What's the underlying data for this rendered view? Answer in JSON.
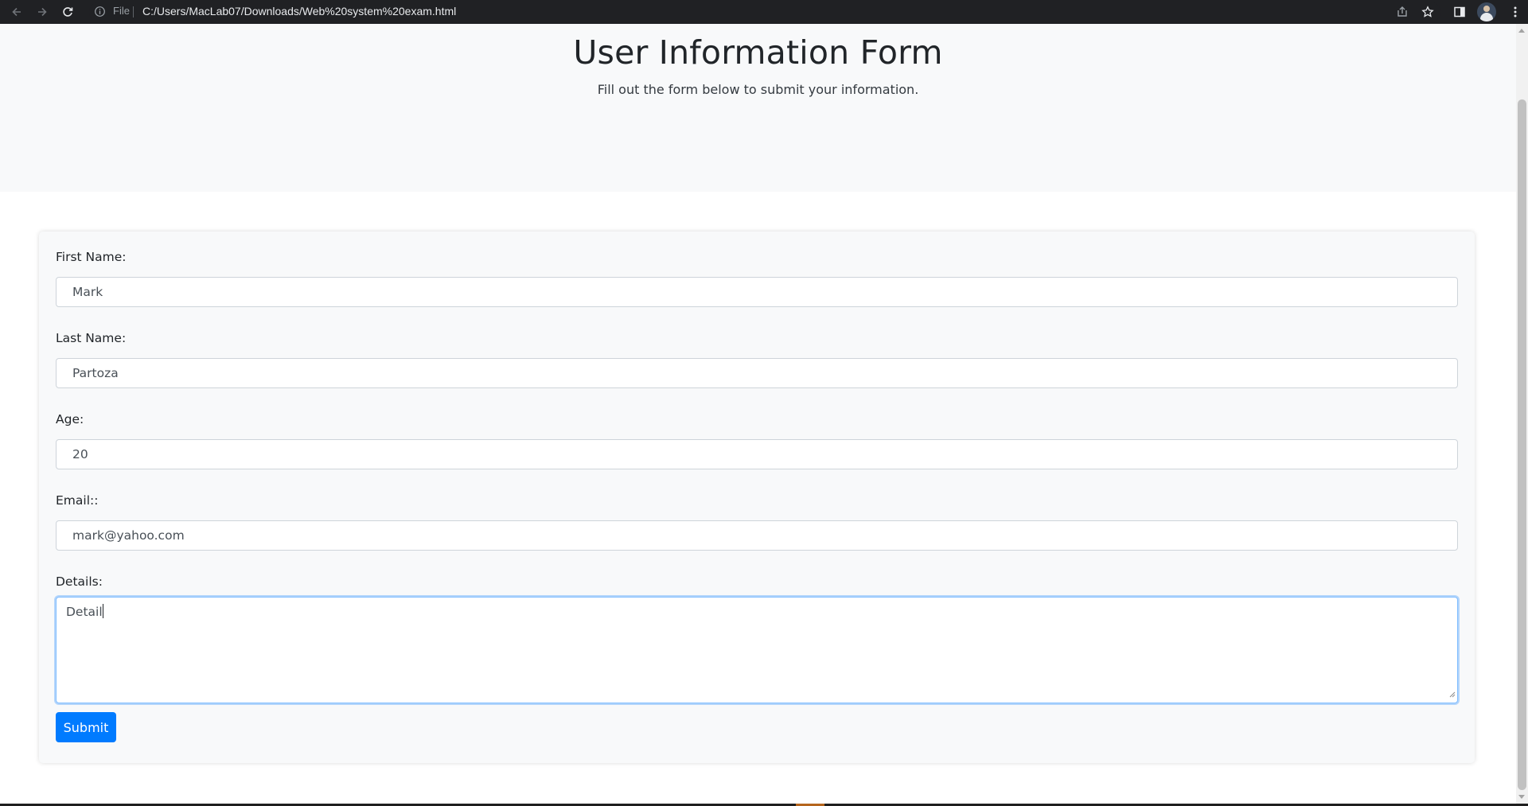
{
  "browser": {
    "scheme_label": "File",
    "url": "C:/Users/MacLab07/Downloads/Web%20system%20exam.html",
    "icons": [
      "back-arrow-icon",
      "forward-arrow-icon",
      "reload-icon",
      "info-icon",
      "share-icon",
      "star-icon",
      "side-panel-icon",
      "profile-avatar",
      "menu-dots-icon"
    ]
  },
  "header": {
    "title": "User Information Form",
    "subtitle": "Fill out the form below to submit your information."
  },
  "form": {
    "first_name": {
      "label": "First Name:",
      "value": "Mark"
    },
    "last_name": {
      "label": "Last Name:",
      "value": "Partoza"
    },
    "age": {
      "label": "Age:",
      "value": "20"
    },
    "email": {
      "label": "Email::",
      "value": "mark@yahoo.com"
    },
    "details": {
      "label": "Details:",
      "value": "Detail"
    },
    "submit_label": "Submit"
  },
  "colors": {
    "primary": "#007bff",
    "jumbotron_bg": "#f8f9fa",
    "browser_bar": "#202124",
    "focus_border": "#80bdff"
  }
}
